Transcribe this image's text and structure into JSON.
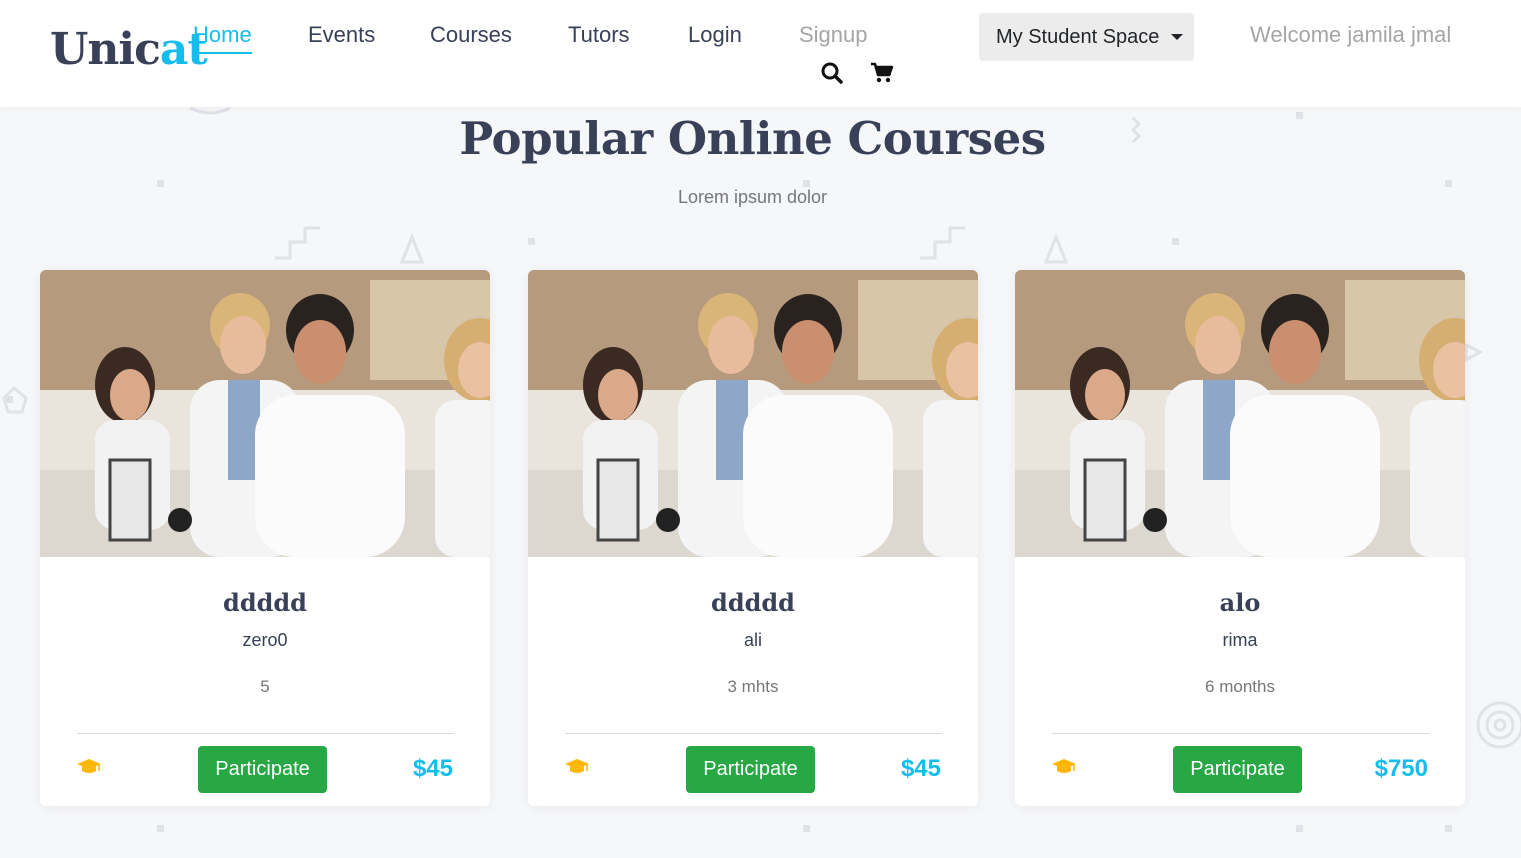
{
  "header": {
    "logo_part1": "Unic",
    "logo_part2": "at",
    "nav": [
      {
        "label": "Home"
      },
      {
        "label": "Events"
      },
      {
        "label": "Courses"
      },
      {
        "label": "Tutors"
      },
      {
        "label": "Login"
      },
      {
        "label": "Signup"
      }
    ],
    "search_icon": "search-icon",
    "cart_icon": "cart-icon",
    "dropdown_label": "My Student Space",
    "welcome_text": "Welcome jamila jmal"
  },
  "section": {
    "title": "Popular Online Courses",
    "subtitle": "Lorem ipsum dolor"
  },
  "courses": [
    {
      "title": "ddddd",
      "teacher": "zero0",
      "duration": "5",
      "button": "Participate",
      "price": "$45",
      "icon": "graduation-cap-icon"
    },
    {
      "title": "ddddd",
      "teacher": "ali",
      "duration": "3 mhts",
      "button": "Participate",
      "price": "$45",
      "icon": "graduation-cap-icon"
    },
    {
      "title": "alo",
      "teacher": "rima",
      "duration": "6 months",
      "button": "Participate",
      "price": "$750",
      "icon": "graduation-cap-icon"
    }
  ],
  "colors": {
    "accent": "#14bdee",
    "dark": "#384158",
    "button_green": "#28a745",
    "cap_yellow": "#ffb606",
    "muted": "#a5a5a5"
  }
}
